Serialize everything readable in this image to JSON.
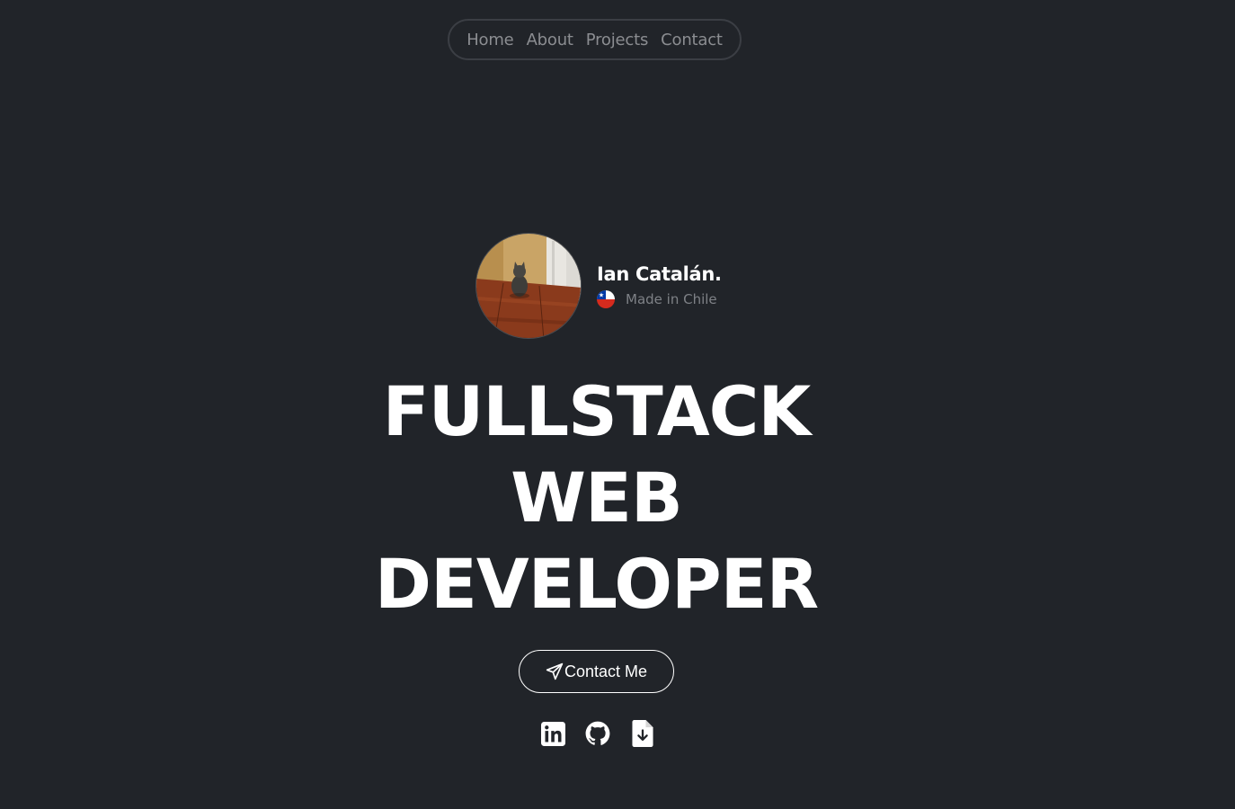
{
  "nav": {
    "items": [
      {
        "label": "Home"
      },
      {
        "label": "About"
      },
      {
        "label": "Projects"
      },
      {
        "label": "Contact"
      }
    ]
  },
  "profile": {
    "name": "Ian Catalán.",
    "origin": "Made in Chile",
    "flag_icon": "chile-flag-icon",
    "avatar_icon": "cat-photo"
  },
  "hero": {
    "lines": [
      "FULLSTACK",
      "WEB",
      "DEVELOPER"
    ]
  },
  "cta": {
    "label": "Contact Me",
    "icon": "paper-plane-icon"
  },
  "socials": [
    {
      "icon": "linkedin-icon"
    },
    {
      "icon": "github-icon"
    },
    {
      "icon": "download-file-icon"
    }
  ],
  "colors": {
    "background": "#212429",
    "nav_text": "#8b8d91",
    "nav_border": "#3b3e44",
    "text": "#ffffff",
    "muted": "#7e8186"
  }
}
